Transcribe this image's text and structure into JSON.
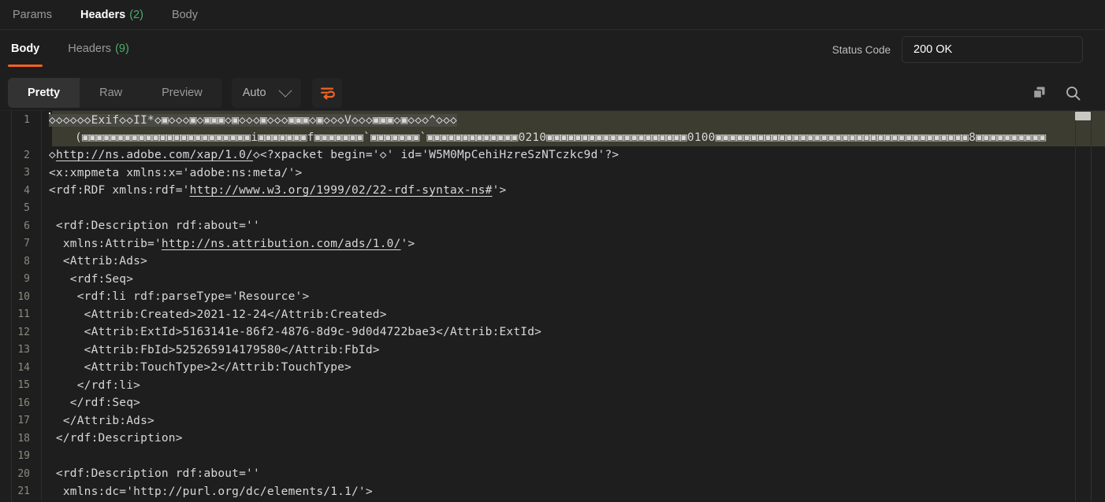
{
  "request_tabs": [
    {
      "label": "Params",
      "count": "",
      "active": false
    },
    {
      "label": "Headers",
      "count": "(2)",
      "active": true
    },
    {
      "label": "Body",
      "count": "",
      "active": false
    }
  ],
  "response_tabs": [
    {
      "label": "Body",
      "count": "",
      "active": true
    },
    {
      "label": "Headers",
      "count": "(9)",
      "active": false
    }
  ],
  "status": {
    "label": "Status Code",
    "value": "200 OK"
  },
  "toolbar": {
    "view_modes": [
      {
        "label": "Pretty",
        "active": true
      },
      {
        "label": "Raw",
        "active": false
      },
      {
        "label": "Preview",
        "active": false
      }
    ],
    "format_select": "Auto",
    "wrap_icon": "word-wrap-icon",
    "copy_icon": "copy-icon",
    "search_icon": "search-icon",
    "chevron_icon": "chevron-down-icon"
  },
  "colors": {
    "accent": "#f26322",
    "count": "#4caf68",
    "background": "#1e1e1e",
    "panel": "#242424",
    "active_segment": "#333333",
    "line_highlight": "#3c3c30",
    "selection": "#4a4a44"
  },
  "editor": {
    "lines": [
      {
        "num": "1",
        "highlighted": true,
        "cursor": true,
        "segments": [
          {
            "text": "◇◇◇◇◇◇Exif◇◇II*◇▣◇◇◇▣◇▣▣▣◇▣◇◇◇▣◇◇◇▣▣▣◇▣◇◇◇V◇◇◇▣▣▣◇▣◇◇◇^◇◇◇",
            "style": "selected"
          }
        ]
      },
      {
        "num": "",
        "wrapped": true,
        "highlighted": true,
        "segments": [
          {
            "text": "(▣▣▣▣▣▣▣▣▣▣▣▣▣▣▣▣▣▣▣▣▣▣▣▣i▣▣▣▣▣▣▣f▣▣▣▣▣▣▣`▣▣▣▣▣▣▣`▣▣▣▣▣▣▣▣▣▣▣▣▣0210▣▣▣▣▣▣▣▣▣▣▣▣▣▣▣▣▣▣▣▣0100▣▣▣▣▣▣▣▣▣▣▣▣▣▣▣▣▣▣▣▣▣▣▣▣▣▣▣▣▣▣▣▣▣▣▣▣8▣▣▣▣▣▣▣▣▣▣",
            "style": "plain"
          }
        ]
      },
      {
        "num": "2",
        "segments": [
          {
            "text": "◇",
            "style": "plain"
          },
          {
            "text": "http://ns.adobe.com/xap/1.0/",
            "style": "url"
          },
          {
            "text": "◇<?xpacket begin='◇' id='W5M0MpCehiHzreSzNTczkc9d'?>",
            "style": "plain"
          }
        ]
      },
      {
        "num": "3",
        "segments": [
          {
            "text": "<x:xmpmeta xmlns:x='adobe:ns:meta/'>",
            "style": "plain"
          }
        ]
      },
      {
        "num": "4",
        "segments": [
          {
            "text": "<rdf:RDF xmlns:rdf='",
            "style": "plain"
          },
          {
            "text": "http://www.w3.org/1999/02/22-rdf-syntax-ns#",
            "style": "url"
          },
          {
            "text": "'>",
            "style": "plain"
          }
        ]
      },
      {
        "num": "5",
        "segments": [
          {
            "text": "",
            "style": "plain"
          }
        ]
      },
      {
        "num": "6",
        "segments": [
          {
            "text": " <rdf:Description rdf:about=''",
            "style": "plain"
          }
        ]
      },
      {
        "num": "7",
        "segments": [
          {
            "text": "  xmlns:Attrib='",
            "style": "plain"
          },
          {
            "text": "http://ns.attribution.com/ads/1.0/",
            "style": "url"
          },
          {
            "text": "'>",
            "style": "plain"
          }
        ]
      },
      {
        "num": "8",
        "segments": [
          {
            "text": "  <Attrib:Ads>",
            "style": "plain"
          }
        ]
      },
      {
        "num": "9",
        "segments": [
          {
            "text": "   <rdf:Seq>",
            "style": "plain"
          }
        ]
      },
      {
        "num": "10",
        "segments": [
          {
            "text": "    <rdf:li rdf:parseType='Resource'>",
            "style": "plain"
          }
        ]
      },
      {
        "num": "11",
        "segments": [
          {
            "text": "     <Attrib:Created>2021-12-24</Attrib:Created>",
            "style": "plain"
          }
        ]
      },
      {
        "num": "12",
        "segments": [
          {
            "text": "     <Attrib:ExtId>5163141e-86f2-4876-8d9c-9d0d4722bae3</Attrib:ExtId>",
            "style": "plain"
          }
        ]
      },
      {
        "num": "13",
        "segments": [
          {
            "text": "     <Attrib:FbId>525265914179580</Attrib:FbId>",
            "style": "plain"
          }
        ]
      },
      {
        "num": "14",
        "segments": [
          {
            "text": "     <Attrib:TouchType>2</Attrib:TouchType>",
            "style": "plain"
          }
        ]
      },
      {
        "num": "15",
        "segments": [
          {
            "text": "    </rdf:li>",
            "style": "plain"
          }
        ]
      },
      {
        "num": "16",
        "segments": [
          {
            "text": "   </rdf:Seq>",
            "style": "plain"
          }
        ]
      },
      {
        "num": "17",
        "segments": [
          {
            "text": "  </Attrib:Ads>",
            "style": "plain"
          }
        ]
      },
      {
        "num": "18",
        "segments": [
          {
            "text": " </rdf:Description>",
            "style": "plain"
          }
        ]
      },
      {
        "num": "19",
        "segments": [
          {
            "text": "",
            "style": "plain"
          }
        ]
      },
      {
        "num": "20",
        "segments": [
          {
            "text": " <rdf:Description rdf:about=''",
            "style": "plain"
          }
        ]
      },
      {
        "num": "21",
        "segments": [
          {
            "text": "  xmlns:dc='http://purl.org/dc/elements/1.1/'>",
            "style": "plain"
          }
        ]
      }
    ]
  }
}
